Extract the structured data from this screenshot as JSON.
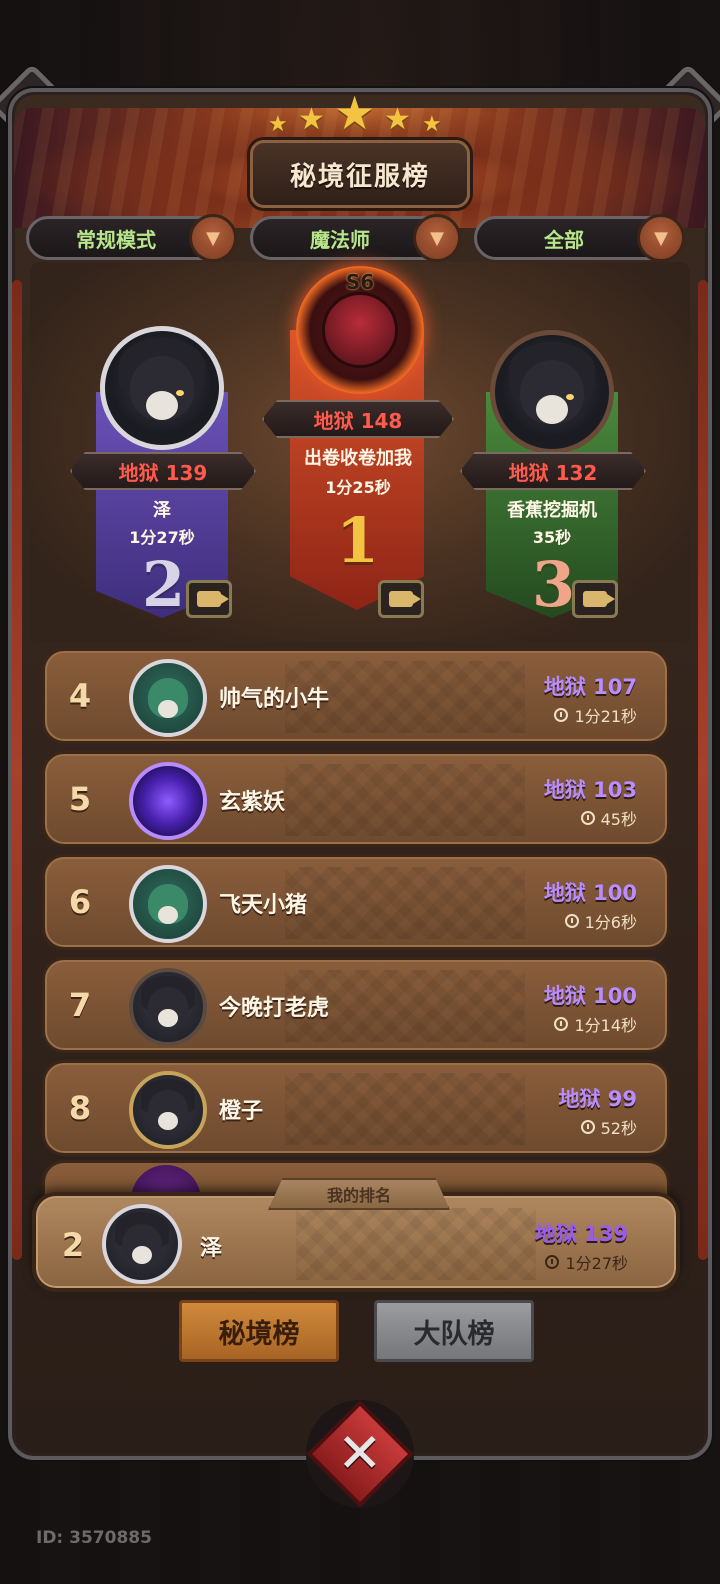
{
  "header": {
    "title": "秘境征服榜"
  },
  "filters": [
    {
      "label": "常规模式"
    },
    {
      "label": "魔法师"
    },
    {
      "label": "全部"
    }
  ],
  "season": {
    "label": "S6"
  },
  "podium": [
    {
      "rank": "1",
      "score": "地狱 148",
      "name": "出卷收卷加我",
      "time": "1分25秒",
      "color": "#d8542a"
    },
    {
      "rank": "2",
      "score": "地狱 139",
      "name": "泽",
      "time": "1分27秒",
      "color": "#6b52b8"
    },
    {
      "rank": "3",
      "score": "地狱 132",
      "name": "香蕉挖掘机",
      "time": "35秒",
      "color": "#4a8a3c"
    }
  ],
  "rows": [
    {
      "rank": "4",
      "name": "帅气的小牛",
      "score": "地狱 107",
      "time": "1分21秒"
    },
    {
      "rank": "5",
      "name": "玄紫妖",
      "score": "地狱 103",
      "time": "45秒"
    },
    {
      "rank": "6",
      "name": "飞天小猪",
      "score": "地狱 100",
      "time": "1分6秒"
    },
    {
      "rank": "7",
      "name": "今晚打老虎",
      "score": "地狱 100",
      "time": "1分14秒"
    },
    {
      "rank": "8",
      "name": "橙子",
      "score": "地狱 99",
      "time": "52秒"
    }
  ],
  "my_rank": {
    "tab_label": "我的排名",
    "rank": "2",
    "name": "泽",
    "score": "地狱 139",
    "time": "1分27秒"
  },
  "tabs": [
    {
      "label": "秘境榜",
      "active": true
    },
    {
      "label": "大队榜",
      "active": false
    }
  ],
  "close": {
    "glyph": "✕"
  },
  "footer": {
    "user_id": "ID: 3570885"
  },
  "colors": {
    "score_red": "#ff5a4c",
    "score_purple": "#b98cff",
    "filter_text": "#b7e68a",
    "tab_active": "#d08a3c"
  }
}
